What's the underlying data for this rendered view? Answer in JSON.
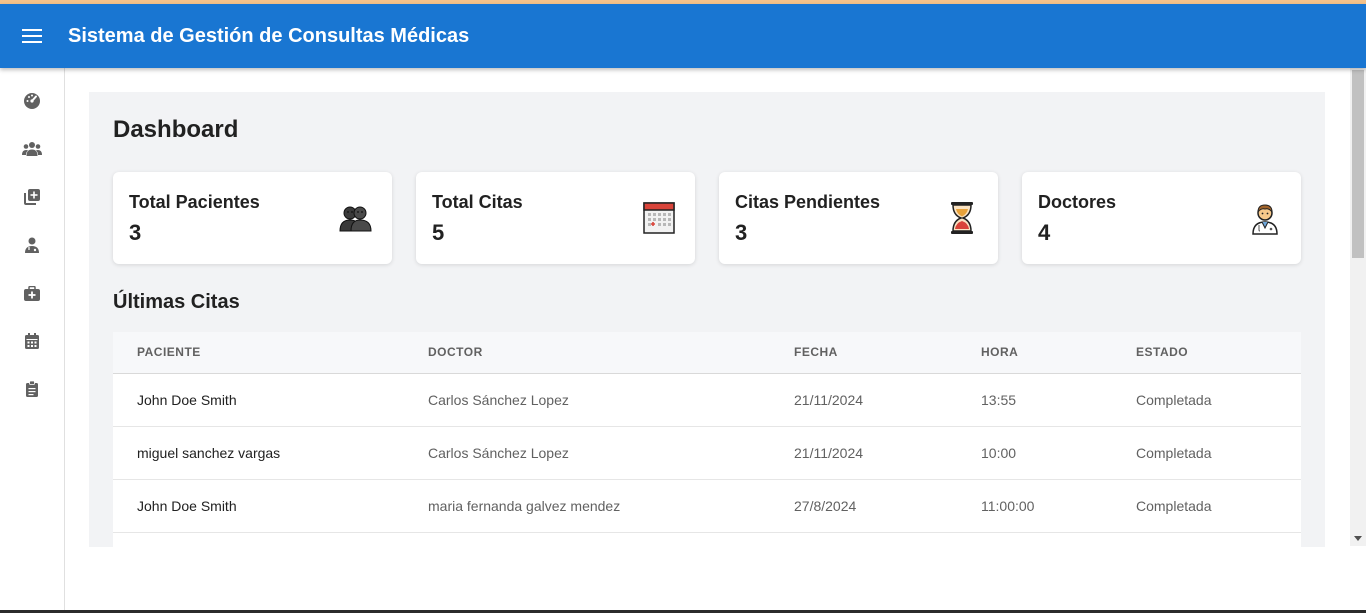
{
  "app": {
    "title": "Sistema de Gestión de Consultas Médicas",
    "accent_color": "#1976d2"
  },
  "sidebar": {
    "items": [
      {
        "icon": "dashboard-icon"
      },
      {
        "icon": "patients-icon"
      },
      {
        "icon": "add-consultation-icon"
      },
      {
        "icon": "doctor-icon"
      },
      {
        "icon": "medical-kit-icon"
      },
      {
        "icon": "calendar-icon"
      },
      {
        "icon": "clipboard-icon"
      }
    ]
  },
  "dashboard": {
    "title": "Dashboard",
    "cards": [
      {
        "label": "Total Pacientes",
        "value": "3",
        "icon": "patients-emoji-icon"
      },
      {
        "label": "Total Citas",
        "value": "5",
        "icon": "calendar-emoji-icon"
      },
      {
        "label": "Citas Pendientes",
        "value": "3",
        "icon": "hourglass-icon"
      },
      {
        "label": "Doctores",
        "value": "4",
        "icon": "health-worker-icon"
      }
    ]
  },
  "appointments": {
    "title": "Últimas Citas",
    "columns": [
      "PACIENTE",
      "DOCTOR",
      "FECHA",
      "HORA",
      "ESTADO"
    ],
    "rows": [
      {
        "patient": "John Doe Smith",
        "doctor": "Carlos Sánchez Lopez",
        "date": "21/11/2024",
        "time": "13:55",
        "status": "Completada"
      },
      {
        "patient": "miguel sanchez vargas",
        "doctor": "Carlos Sánchez Lopez",
        "date": "21/11/2024",
        "time": "10:00",
        "status": "Completada"
      },
      {
        "patient": "John Doe Smith",
        "doctor": "maria fernanda galvez mendez",
        "date": "27/8/2024",
        "time": "11:00:00",
        "status": "Completada"
      }
    ]
  }
}
